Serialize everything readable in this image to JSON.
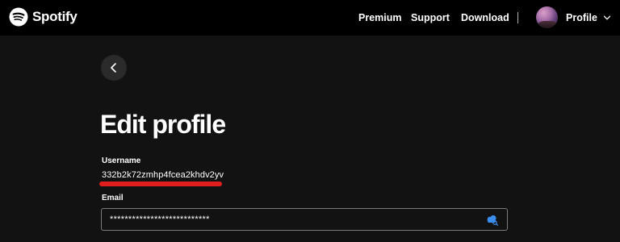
{
  "header": {
    "brand": "Spotify",
    "nav": {
      "premium": "Premium",
      "support": "Support",
      "download": "Download"
    },
    "profile_label": "Profile"
  },
  "page": {
    "title": "Edit profile",
    "username": {
      "label": "Username",
      "value": "332b2k72zmhp4fcea2khdv2yv"
    },
    "email": {
      "label": "Email",
      "value": "***************************"
    }
  },
  "colors": {
    "background": "#121212",
    "topbar": "#000000",
    "back_button": "#2a2a2a",
    "highlight_underline": "#e01e1e",
    "autofill_icon": "#3b8ef0"
  },
  "icons": {
    "logo": "spotify-logo-icon",
    "back": "chevron-left-icon",
    "profile_menu": "chevron-down-icon",
    "email_autofill": "password-manager-icon"
  }
}
